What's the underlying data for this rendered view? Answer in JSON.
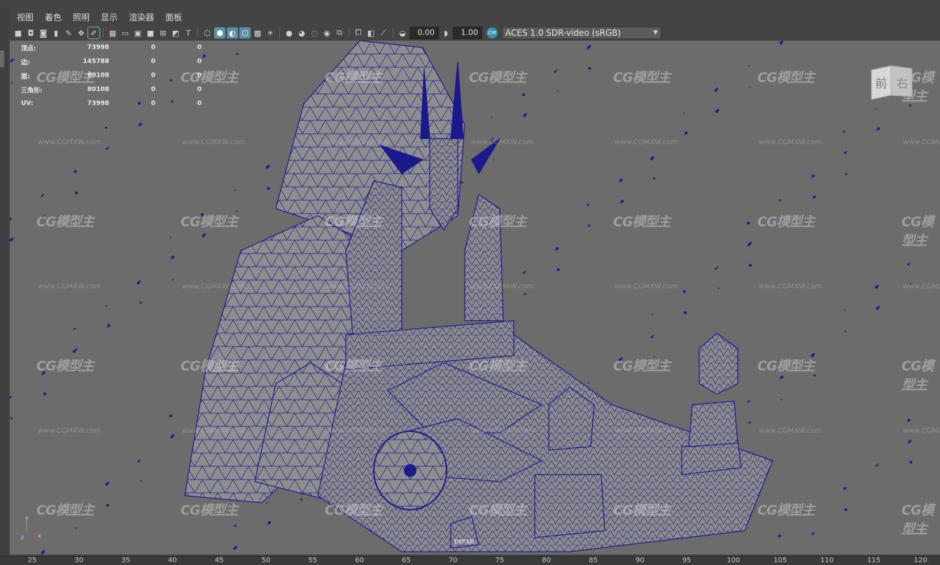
{
  "menu": [
    "视图",
    "着色",
    "照明",
    "显示",
    "渲染器",
    "面板"
  ],
  "toolbar": {
    "exposure": "0.00",
    "gamma": "1.00",
    "color_space": "ACES 1.0 SDR-video (sRGB)"
  },
  "hud": {
    "rows": [
      {
        "label": "顶点:",
        "value": "73998",
        "a": "0",
        "b": "0"
      },
      {
        "label": "边:",
        "value": "145788",
        "a": "0",
        "b": "0"
      },
      {
        "label": "面:",
        "value": "80108",
        "a": "0",
        "b": "0"
      },
      {
        "label": "三角形:",
        "value": "80108",
        "a": "0",
        "b": "0"
      },
      {
        "label": "UV:",
        "value": "73998",
        "a": "0",
        "b": "0"
      }
    ]
  },
  "viewcube": {
    "front": "前",
    "right": "右"
  },
  "camera": "persp",
  "watermark": {
    "brand": "CG模型主",
    "url": "www.CGMXW.com"
  },
  "axis": {
    "y": "y",
    "z": "z",
    "x": "x"
  },
  "ruler": [
    "25",
    "30",
    "35",
    "40",
    "45",
    "50",
    "55",
    "60",
    "65",
    "70",
    "75",
    "80",
    "85",
    "90",
    "95",
    "100",
    "105",
    "110",
    "115",
    "120"
  ],
  "colors": {
    "wire": "#1a1a8c",
    "mesh": "#8e8e8e",
    "viewport": "#6c6c6c",
    "accent": "#5a8fa8"
  }
}
